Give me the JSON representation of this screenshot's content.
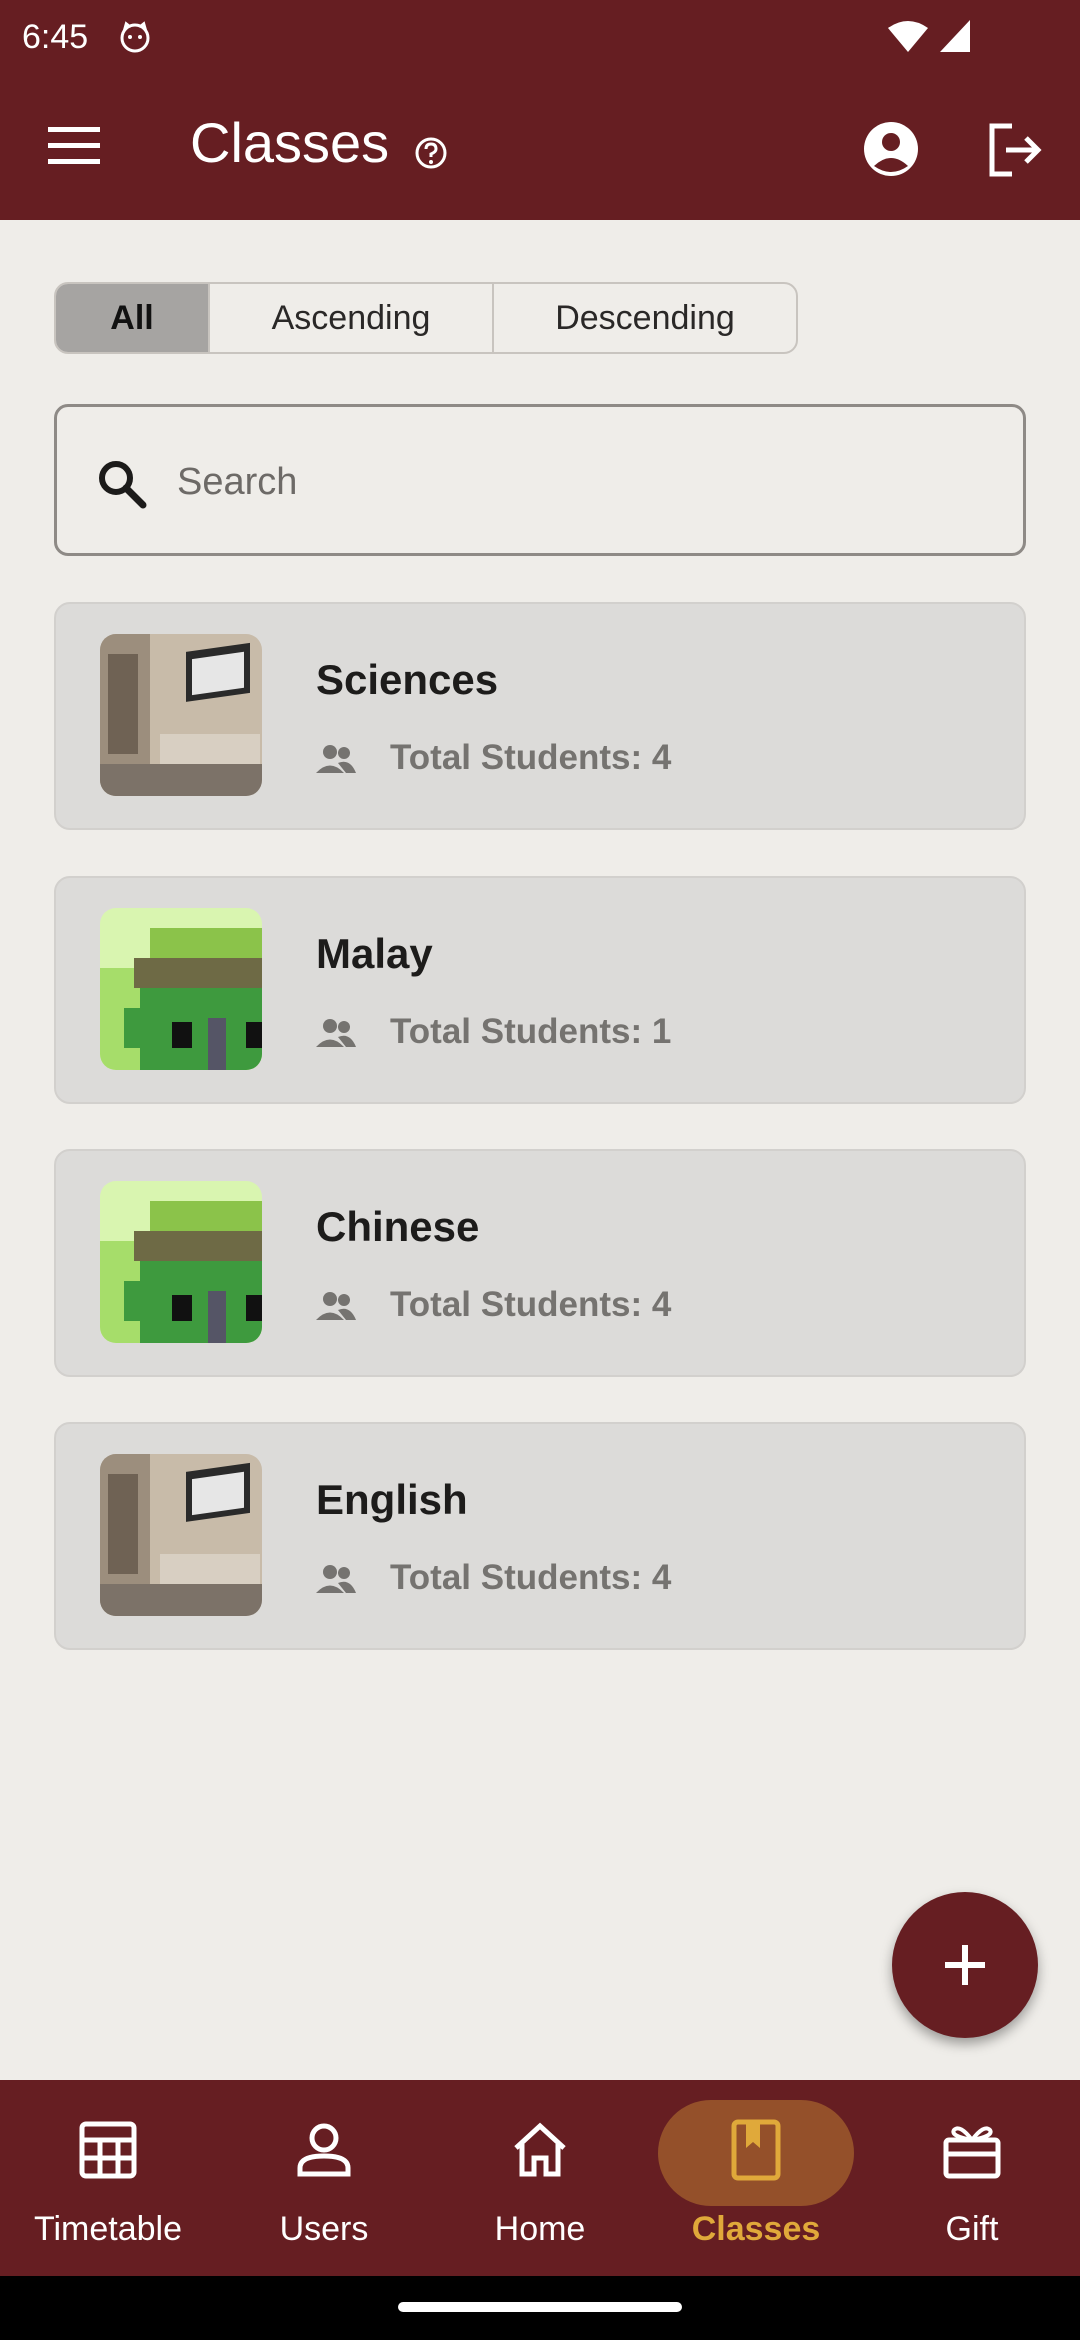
{
  "status_bar": {
    "time": "6:45"
  },
  "app_bar": {
    "title": "Classes"
  },
  "filters": {
    "options": [
      "All",
      "Ascending",
      "Descending"
    ],
    "selected": "All"
  },
  "search": {
    "placeholder": "Search",
    "value": ""
  },
  "classes": [
    {
      "name": "Sciences",
      "students": "Total Students: 4",
      "thumbnail": "living-room"
    },
    {
      "name": "Malay",
      "students": "Total Students: 1",
      "thumbnail": "pixel-building"
    },
    {
      "name": "Chinese",
      "students": "Total Students: 4",
      "thumbnail": "pixel-building"
    },
    {
      "name": "English",
      "students": "Total Students: 4",
      "thumbnail": "living-room"
    }
  ],
  "bottom_nav": {
    "items": [
      {
        "label": "Timetable",
        "icon": "table-icon"
      },
      {
        "label": "Users",
        "icon": "person-icon"
      },
      {
        "label": "Home",
        "icon": "home-icon"
      },
      {
        "label": "Classes",
        "icon": "bookmark-book-icon"
      },
      {
        "label": "Gift",
        "icon": "gift-icon"
      }
    ],
    "active": "Classes"
  },
  "colors": {
    "primary": "#661e22",
    "background": "#efede9",
    "card": "#dcdbd9",
    "active_nav_label": "#e0a93a",
    "active_nav_pill": "#94502a"
  }
}
